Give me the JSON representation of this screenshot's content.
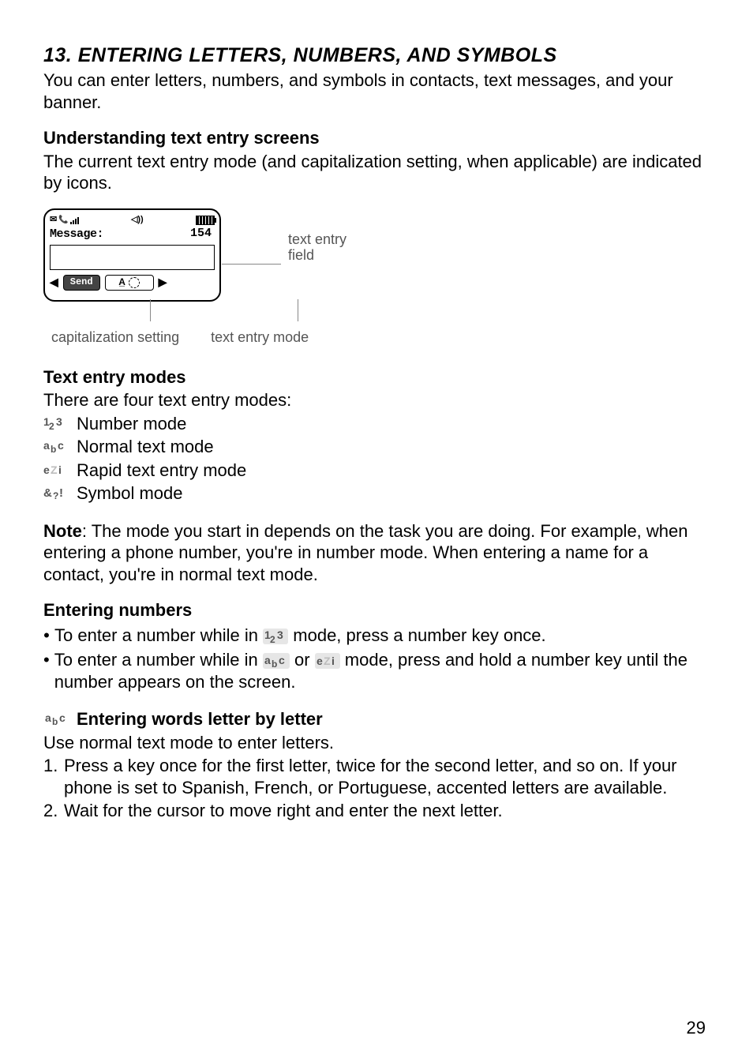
{
  "section": {
    "number_title": "13. ENTERING LETTERS, NUMBERS, AND SYMBOLS",
    "intro": "You can enter letters, numbers, and symbols in contacts, text messages, and your banner."
  },
  "sub_understanding": {
    "heading": "Understanding text entry screens",
    "body": "The current text entry mode (and capitalization setting, when applicable) are indicated by icons."
  },
  "figure": {
    "msg_label": "Message:",
    "char_count": "154",
    "send_label": "Send",
    "annot_field": "text entry\nfield",
    "annot_cap": "capitalization setting",
    "annot_mode": "text entry mode"
  },
  "sub_modes": {
    "heading": "Text entry modes",
    "intro": "There are four text entry modes:",
    "items": {
      "number": "Number mode",
      "normal": "Normal text mode",
      "rapid": "Rapid text entry mode",
      "symbol": "Symbol mode"
    }
  },
  "note": {
    "label": "Note",
    "body": ": The mode you start in depends on the task you are doing. For example, when entering a phone number, you're in number mode. When entering a name for a contact, you're in normal text mode."
  },
  "sub_numbers": {
    "heading": "Entering numbers",
    "li1_a": "To enter a number while in ",
    "li1_b": " mode, press a number key once.",
    "li2_a": "To enter a number while in ",
    "li2_b": " or ",
    "li2_c": " mode, press and hold a number key until the number appears on the screen."
  },
  "sub_letters": {
    "heading": "Entering words letter by letter",
    "intro": "Use normal text mode to enter letters.",
    "steps": {
      "s1": "Press a key once for the first letter, twice for the second letter, and so on. If your phone is set to Spanish, French, or Portuguese, accented letters are available.",
      "s2": "Wait for the cursor to move right and enter the next letter."
    }
  },
  "page_number": "29"
}
